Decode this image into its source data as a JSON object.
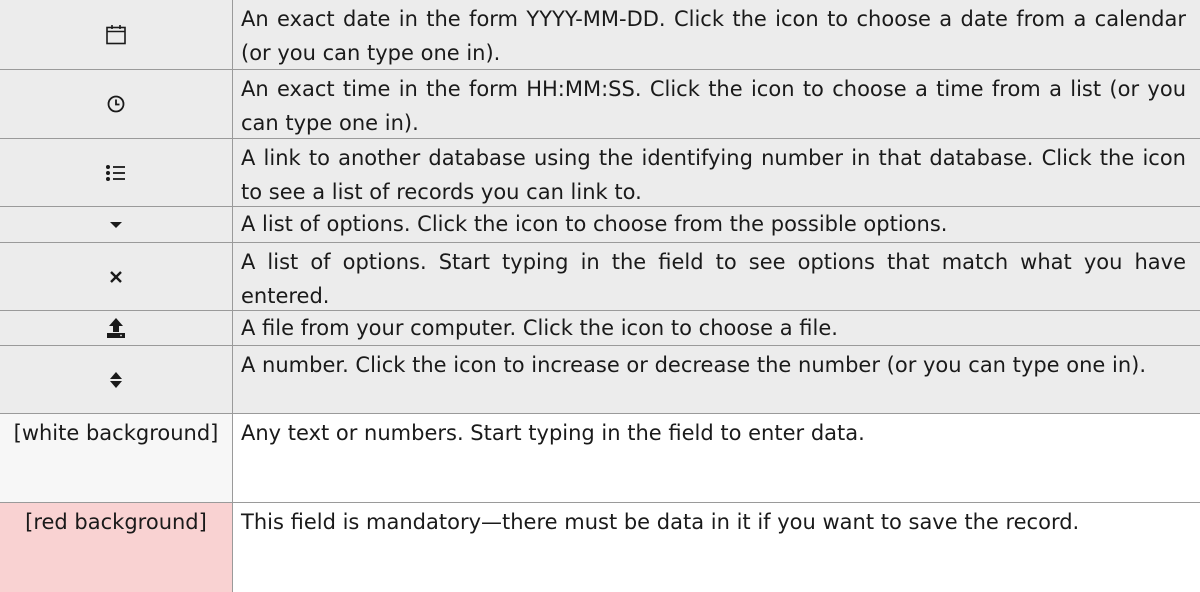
{
  "rows": [
    {
      "icon": "calendar-icon",
      "text": "An exact date in the form YYYY-MM-DD. Click the icon to choose a date from a calendar (or you can type one in)."
    },
    {
      "icon": "clock-icon",
      "text": "An exact time in the form HH:MM:SS. Click the icon to choose a time from a list (or you can type one in)."
    },
    {
      "icon": "list-icon",
      "text": "A link to another database using the identifying number in that database. Click the icon to see a list of records you can link to."
    },
    {
      "icon": "caret-down-icon",
      "text": "A list of options. Click the icon to choose from the possible options."
    },
    {
      "icon": "close-icon",
      "text": "A list of options. Start typing in the field to see options that match what you have entered."
    },
    {
      "icon": "upload-icon",
      "text": "A file from your computer. Click the icon to choose a file."
    },
    {
      "icon": "sort-icon",
      "text": "A number. Click the icon to increase or decrease the number (or you can type one in)."
    },
    {
      "label": "[white background]",
      "text": "Any text or numbers. Start typing in the field to enter data."
    },
    {
      "label": "[red background]",
      "text": "This field is mandatory—there must be data in it if you want to save the record."
    }
  ],
  "colors": {
    "cell_gray": "#ececec",
    "white_swatch": "#f7f7f7",
    "red_swatch": "#f9d2d2",
    "border": "#9a9a9a"
  }
}
